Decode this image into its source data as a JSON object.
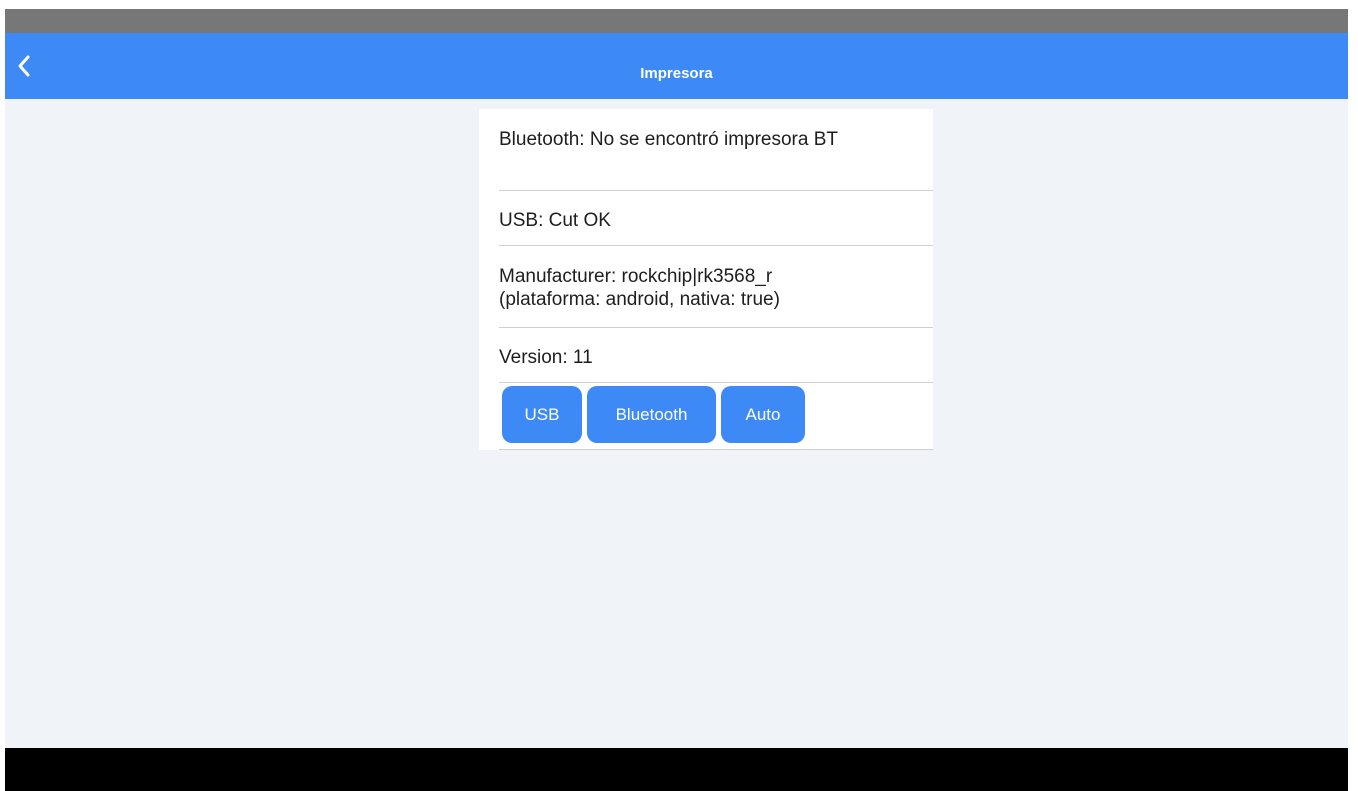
{
  "app_bar": {
    "title": "Impresora",
    "back_icon": "chevron-left-icon"
  },
  "info": {
    "bluetooth_status": "Bluetooth: No se encontró impresora BT",
    "usb_status": "USB: Cut OK",
    "manufacturer_line1": "Manufacturer: rockchip|rk3568_r",
    "manufacturer_line2": "(plataforma: android, nativa: true)",
    "version": "Version: 11"
  },
  "buttons": {
    "usb": "USB",
    "bluetooth": "Bluetooth",
    "auto": "Auto"
  },
  "colors": {
    "accent": "#3d8af7",
    "background": "#f0f4f8",
    "status_bar": "#777777"
  }
}
